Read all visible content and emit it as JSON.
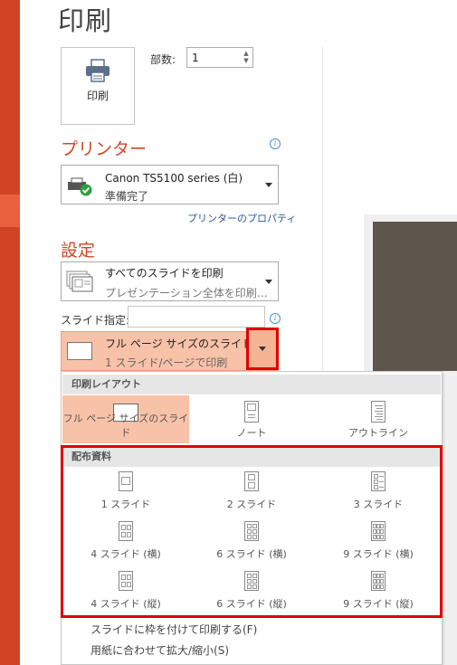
{
  "title": "印刷",
  "print_button": {
    "label": "印刷",
    "icon": "printer-icon"
  },
  "copies": {
    "label": "部数:",
    "value": "1"
  },
  "printer": {
    "heading": "プリンター",
    "name": "Canon TS5100 series (白)",
    "status": "準備完了",
    "properties_link": "プリンターのプロパティ"
  },
  "settings": {
    "heading": "設定",
    "slides_dropdown": {
      "title": "すべてのスライドを印刷",
      "subtitle": "プレゼンテーション全体を印刷…"
    },
    "slides_label": "スライド指定:",
    "slides_value": "",
    "layout_dropdown": {
      "title": "フル ページ サイズのスライド",
      "subtitle": "1 スライド/ページで印刷"
    }
  },
  "popup": {
    "layout_heading": "印刷レイアウト",
    "layout_options": [
      "フル ページ サイズのスライド",
      "ノート",
      "アウトライン"
    ],
    "handouts_heading": "配布資料",
    "handout_options": [
      "1 スライド",
      "2 スライド",
      "3 スライド",
      "4 スライド (横)",
      "6 スライド (横)",
      "9 スライド (横)",
      "4 スライド (縦)",
      "6 スライド (縦)",
      "9 スライド (縦)"
    ],
    "frame_option": "スライドに枠を付けて印刷する(F)",
    "scale_option": "用紙に合わせて拡大/縮小(S)"
  },
  "colors": {
    "accent": "#d24726",
    "rail": "#d04425",
    "selected": "#f8c2a8",
    "highlight_frame": "#e00000"
  }
}
